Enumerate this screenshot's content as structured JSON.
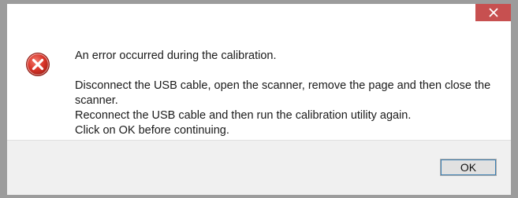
{
  "window": {
    "close_icon": "close-icon",
    "close_color": "#c75050"
  },
  "dialog": {
    "icon": "error-icon",
    "icon_color": "#c0392b",
    "heading": "An error occurred during the calibration.",
    "lines": [
      "Disconnect the USB cable, open the scanner, remove the page and then close the scanner.",
      "Reconnect the USB cable and then run the calibration utility again.",
      "Click on OK before continuing."
    ]
  },
  "footer": {
    "ok_label": "OK"
  }
}
